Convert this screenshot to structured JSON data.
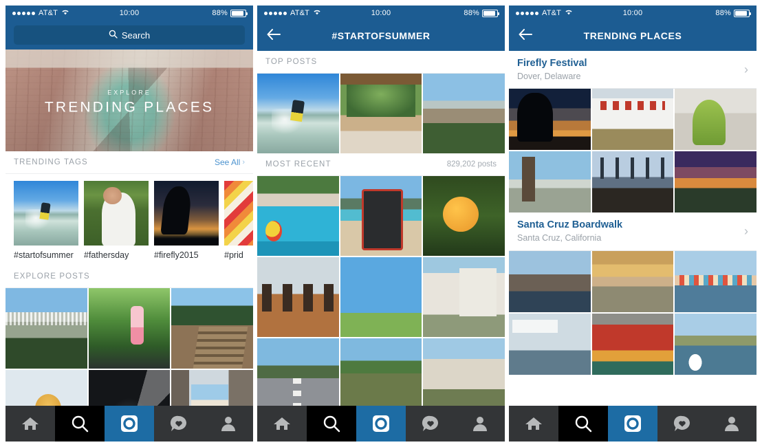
{
  "status_bar": {
    "carrier": "AT&T",
    "time": "10:00",
    "battery_percent": "88%",
    "signal_dots": 5,
    "wifi_icon": "wifi-icon"
  },
  "colors": {
    "header_blue": "#1c5c92",
    "search_field_blue": "#17527f",
    "link_blue": "#4c93cf",
    "place_title_blue": "#1f5f93",
    "tab_active_blue": "#1d6ca4",
    "tab_bar_dark": "#333537",
    "tab_search_dark": "#000000",
    "section_label_gray": "#9aa1a8"
  },
  "screen_explore": {
    "search": {
      "placeholder": "Search",
      "icon": "search-icon"
    },
    "hero": {
      "kicker": "EXPLORE",
      "title": "TRENDING PLACES",
      "image_alt": "brick-corridor-symmetry"
    },
    "trending_tags": {
      "section_title": "TRENDING TAGS",
      "see_all_label": "See All",
      "see_all_icon": "chevron-right-icon",
      "tags": [
        {
          "label": "#startofsummer",
          "image_alt": "water-skier-lake"
        },
        {
          "label": "#fathersday",
          "image_alt": "man-holding-puppy"
        },
        {
          "label": "#firefly2015",
          "image_alt": "silhouette-sunset-crowd"
        },
        {
          "label": "#prid",
          "image_alt": "rainbow-pride-pattern"
        }
      ]
    },
    "explore_posts": {
      "section_title": "EXPLORE POSTS",
      "photos": [
        {
          "image_alt": "hillside-city-view"
        },
        {
          "image_alt": "yoga-on-springs-green"
        },
        {
          "image_alt": "dirt-stairs-trail"
        },
        {
          "image_alt": "woman-straw-hat"
        },
        {
          "image_alt": "dark-tunnel-lights"
        },
        {
          "image_alt": "alley-between-buildings"
        }
      ]
    }
  },
  "screen_hashtag": {
    "nav": {
      "back_icon": "back-arrow-icon",
      "title": "#STARTOFSUMMER"
    },
    "top_posts": {
      "section_title": "TOP POSTS",
      "photos": [
        {
          "image_alt": "wakeboarder-spray"
        },
        {
          "image_alt": "hammock-pavilion-forest"
        },
        {
          "image_alt": "bay-city-overlook"
        }
      ]
    },
    "most_recent": {
      "section_title": "MOST RECENT",
      "post_count": "829,202 posts",
      "photos": [
        {
          "image_alt": "crowded-swimming-pool"
        },
        {
          "image_alt": "ereader-on-beach"
        },
        {
          "image_alt": "orange-tree-fruit"
        },
        {
          "image_alt": "three-chairs-deck"
        },
        {
          "image_alt": "blue-sky-field"
        },
        {
          "image_alt": "house-with-truck"
        },
        {
          "image_alt": "open-road-lines"
        },
        {
          "image_alt": "park-path-trees"
        },
        {
          "image_alt": "suburban-street-homes"
        }
      ]
    }
  },
  "screen_places": {
    "nav": {
      "back_icon": "back-arrow-icon",
      "title": "TRENDING PLACES"
    },
    "places": [
      {
        "name": "Firefly Festival",
        "location": "Dover, Delaware",
        "chevron_icon": "chevron-right-icon",
        "photos": [
          {
            "image_alt": "silhouette-hands-sunset"
          },
          {
            "image_alt": "records-tent-sign"
          },
          {
            "image_alt": "green-costume-crowd"
          },
          {
            "image_alt": "stilt-walker-festival"
          },
          {
            "image_alt": "concert-stage-crowd"
          },
          {
            "image_alt": "festival-sunset-trees"
          }
        ]
      },
      {
        "name": "Santa Cruz Boardwalk",
        "location": "Santa Cruz, California",
        "chevron_icon": "chevron-right-icon",
        "photos": [
          {
            "image_alt": "wharf-pier-dusk"
          },
          {
            "image_alt": "beach-sunset-reflection"
          },
          {
            "image_alt": "colorful-cliff-houses"
          },
          {
            "image_alt": "fish-market-sign"
          },
          {
            "image_alt": "red-food-stall"
          },
          {
            "image_alt": "two-seagulls-water"
          }
        ]
      }
    ]
  },
  "tab_bar": {
    "tabs": [
      {
        "name": "home",
        "icon": "home-icon",
        "state": "inactive"
      },
      {
        "name": "search",
        "icon": "search-icon",
        "state": "dark"
      },
      {
        "name": "explore",
        "icon": "camera-explore-icon",
        "state": "active"
      },
      {
        "name": "activity",
        "icon": "heart-speech-icon",
        "state": "inactive"
      },
      {
        "name": "profile",
        "icon": "person-icon",
        "state": "inactive"
      }
    ]
  }
}
